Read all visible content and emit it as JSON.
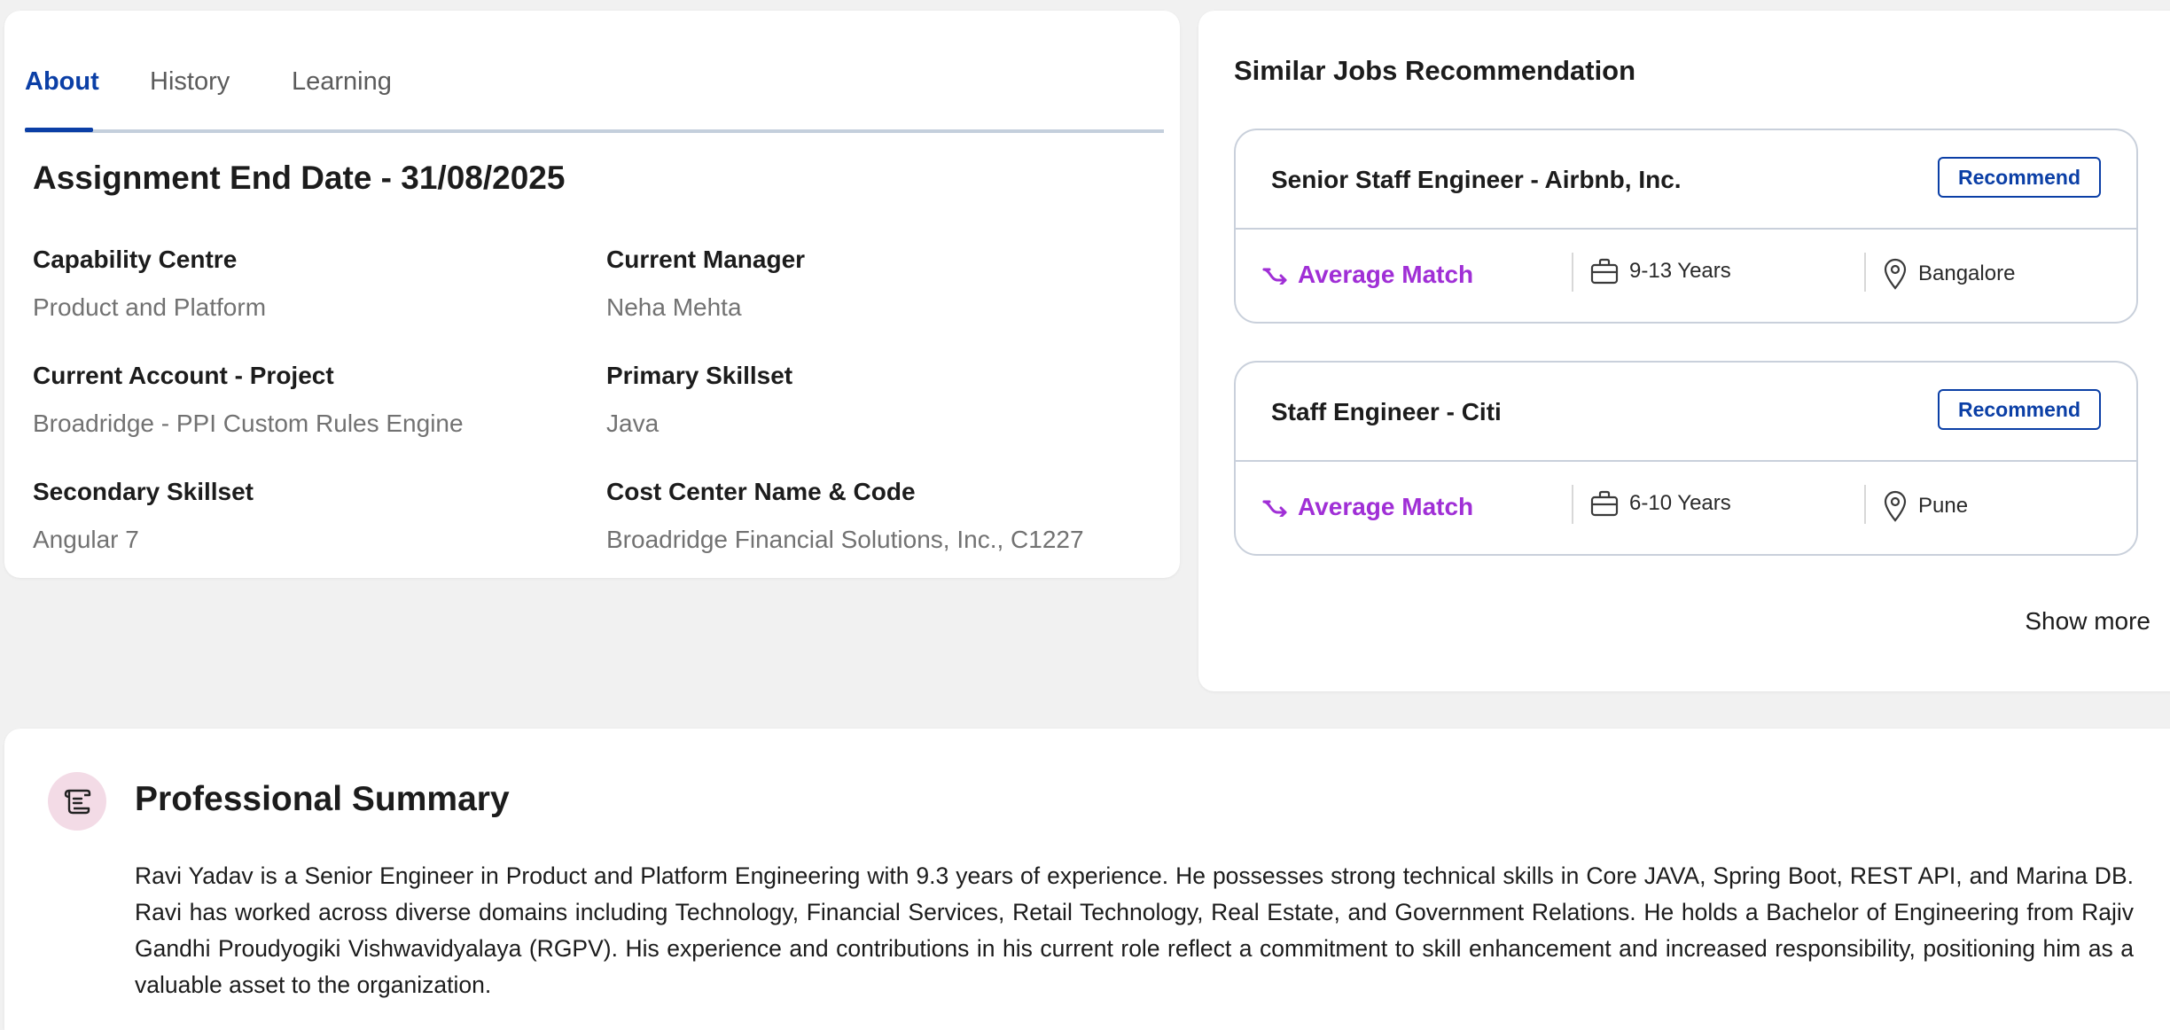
{
  "tabs": [
    {
      "label": "About",
      "active": true
    },
    {
      "label": "History",
      "active": false
    },
    {
      "label": "Learning",
      "active": false
    }
  ],
  "about": {
    "assignment_end": "Assignment End Date - 31/08/2025",
    "fields": [
      {
        "label": "Capability Centre",
        "value": "Product and Platform"
      },
      {
        "label": "Current Manager",
        "value": "Neha Mehta"
      },
      {
        "label": "Current Account - Project",
        "value": "Broadridge - PPI Custom Rules Engine"
      },
      {
        "label": "Primary Skillset",
        "value": "Java"
      },
      {
        "label": "Secondary Skillset",
        "value": "Angular 7"
      },
      {
        "label": "Cost Center Name & Code",
        "value": "Broadridge Financial Solutions, Inc., C1227"
      }
    ]
  },
  "jobs": {
    "title": "Similar Jobs Recommendation",
    "items": [
      {
        "title": "Senior Staff Engineer - Airbnb, Inc.",
        "button": "Recommend",
        "match": "Average Match",
        "experience": "9-13 Years",
        "location": "Bangalore"
      },
      {
        "title": "Staff Engineer - Citi",
        "button": "Recommend",
        "match": "Average Match",
        "experience": "6-10 Years",
        "location": "Pune"
      }
    ],
    "show_more": "Show more"
  },
  "summary": {
    "title": "Professional Summary",
    "icon": "scroll-icon",
    "text": "Ravi Yadav is a Senior Engineer in Product and Platform Engineering with 9.3 years of experience. He possesses strong technical skills in Core JAVA, Spring Boot, REST API, and Marina DB. Ravi has worked across diverse domains including Technology, Financial Services, Retail Technology, Real Estate, and Government Relations. He holds a Bachelor of Engineering from Rajiv Gandhi Proudyogiki Vishwavidyalaya (RGPV). His experience and contributions in his current role reflect a commitment to skill enhancement and increased responsibility, positioning him as a valuable asset to the organization."
  },
  "colors": {
    "accent": "#0b3fa6",
    "match": "#a02fd6",
    "icon_bg": "#f3dbe6",
    "page_bg": "#f1f1f1"
  }
}
